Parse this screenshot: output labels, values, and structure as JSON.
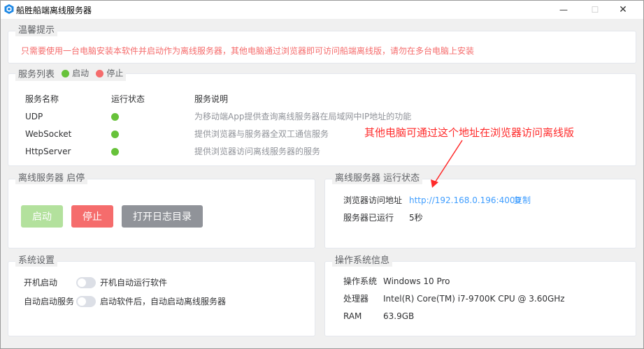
{
  "window": {
    "title": "船胜船端离线服务器",
    "min_glyph": "—",
    "max_glyph": "☐",
    "close_glyph": "✕"
  },
  "tip": {
    "legend": "温馨提示",
    "text": "只需要使用一台电脑安装本软件并启动作为离线服务器，其他电脑通过浏览器即可访问船端离线版，请勿在多台电脑上安装"
  },
  "services": {
    "legend": "服务列表",
    "legend_running": "启动",
    "legend_stopped": "停止",
    "headers": [
      "服务名称",
      "运行状态",
      "服务说明"
    ],
    "rows": [
      {
        "name": "UDP",
        "desc": "为移动端App提供查询离线服务器在局域网中IP地址的功能"
      },
      {
        "name": "WebSocket",
        "desc": "提供浏览器与服务器全双工通信服务"
      },
      {
        "name": "HttpServer",
        "desc": "提供浏览器访问离线服务器的服务"
      }
    ]
  },
  "annotation": "其他电脑可通过这个地址在浏览器访问离线版",
  "control": {
    "legend": "离线服务器 启停",
    "start_label": "启动",
    "stop_label": "停止",
    "open_log_label": "打开日志目录"
  },
  "runtime": {
    "legend": "离线服务器 运行状态",
    "url_label": "浏览器访问地址",
    "url": "http://192.168.0.196:4000",
    "copy_label": "复制",
    "uptime_label": "服务器已运行",
    "uptime": "5秒"
  },
  "settings": {
    "legend": "系统设置",
    "autostart_label": "开机启动",
    "autostart_text": "开机自动运行软件",
    "autoservice_label": "自动启动服务",
    "autoservice_text": "启动软件后，自动启动离线服务器"
  },
  "os": {
    "legend": "操作系统信息",
    "os_label": "操作系统",
    "os_value": "Windows 10 Pro",
    "cpu_label": "处理器",
    "cpu_value": "Intel(R) Core(TM) i7-9700K CPU @ 3.60GHz",
    "ram_label": "RAM",
    "ram_value": "63.9GB"
  },
  "colors": {
    "running": "#67c23a",
    "stopped": "#f56c6c",
    "link": "#409eff",
    "warning": "#f56c6c",
    "annotation": "#ff2a2a"
  }
}
